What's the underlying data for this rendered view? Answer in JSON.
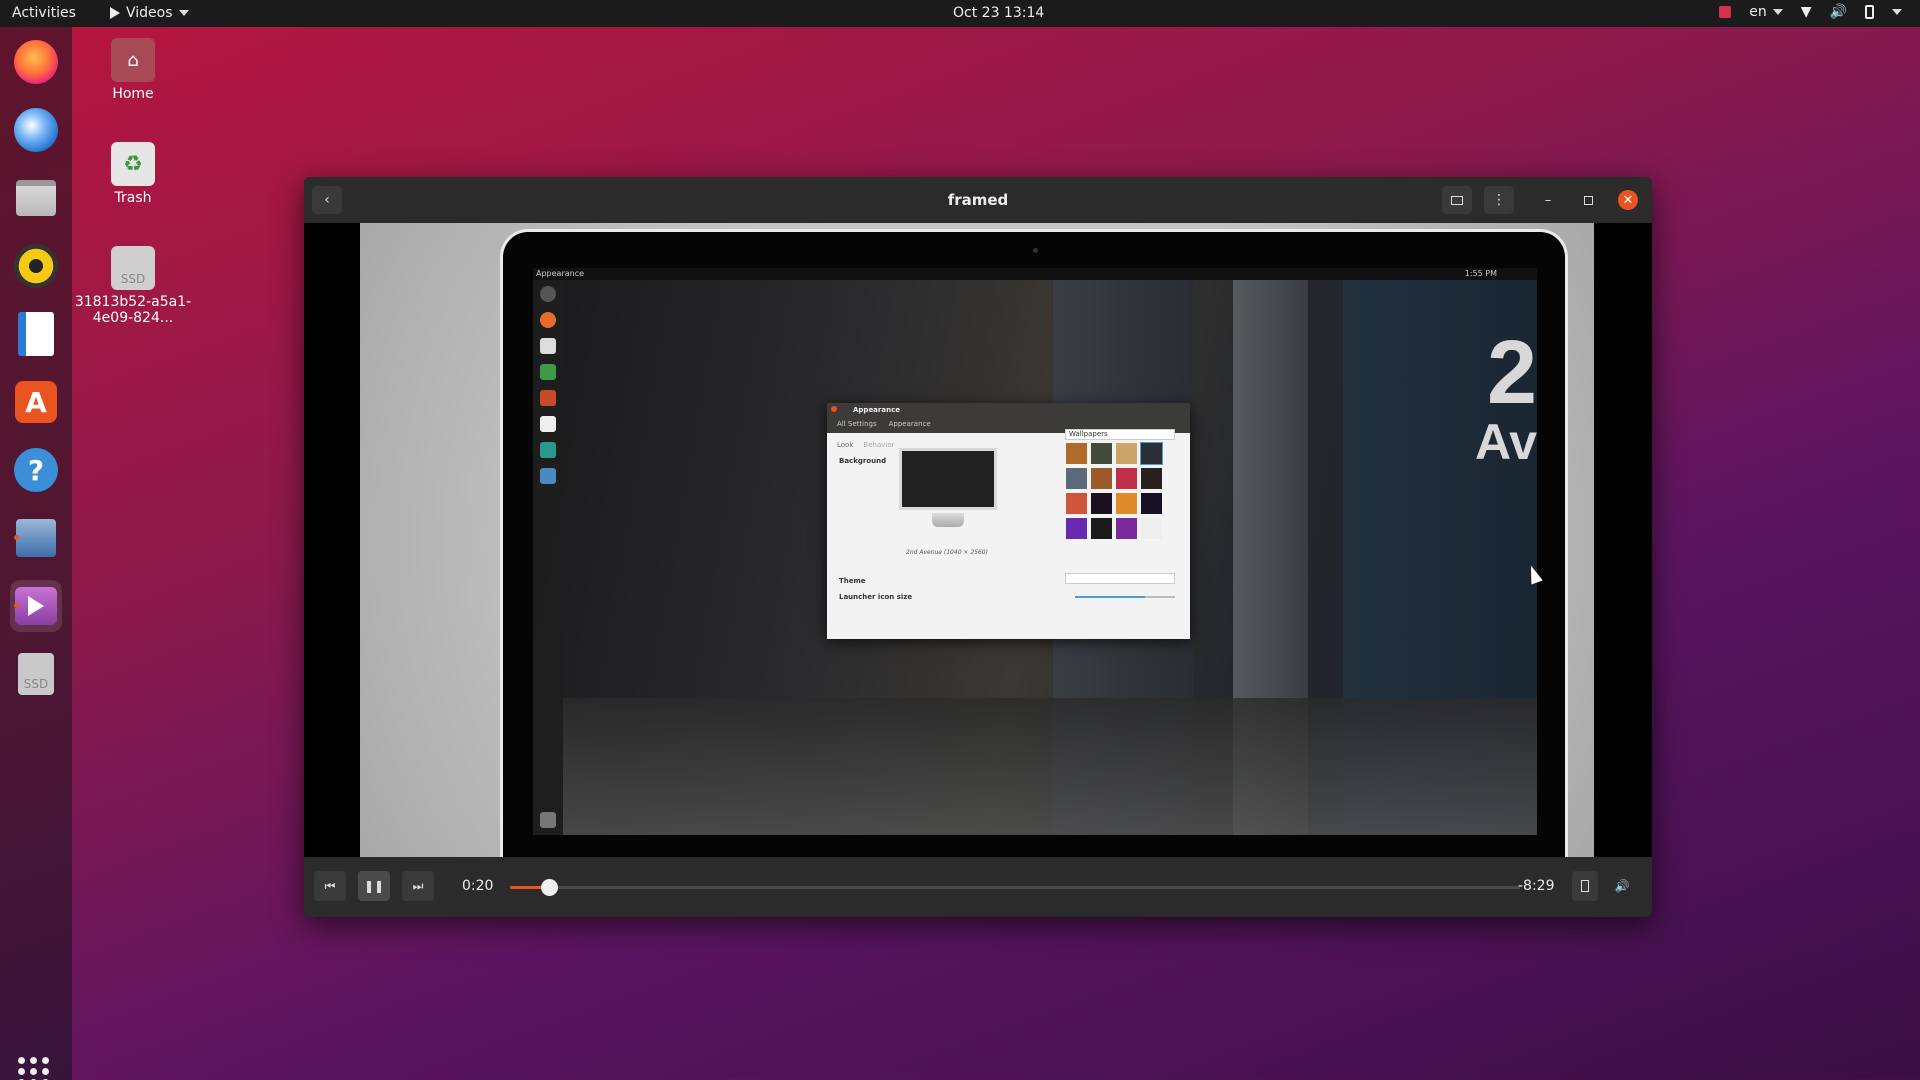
{
  "topbar": {
    "activities": "Activities",
    "app_menu": "Videos",
    "clock": "Oct 23  13:14",
    "lang": "en"
  },
  "desktop": {
    "icons": [
      {
        "label": "Home"
      },
      {
        "label": "Trash"
      },
      {
        "label": "31813b52-a5a1-4e09-824..."
      }
    ],
    "ssd_label": "SSD"
  },
  "window": {
    "title": "framed",
    "video": {
      "inner_topbar_left": "Appearance",
      "inner_topbar_right": "1:55 PM",
      "sign_number": "2",
      "sign_text": "Av",
      "appearance_dialog": {
        "title": "Appearance",
        "tabs": [
          "All Settings",
          "Appearance"
        ],
        "subtabs": [
          "Look",
          "Behavior"
        ],
        "background_label": "Background",
        "wallpaper_dropdown": "Wallpapers",
        "caption": "2nd Avenue (1040 × 2560)",
        "theme_label": "Theme",
        "launcher_icon_size_label": "Launcher icon size"
      }
    },
    "controls": {
      "elapsed": "0:20",
      "remaining": "-8:29",
      "progress": 0.039
    }
  },
  "colors": {
    "accent": "#e95420",
    "titlebar": "#2b2b2b",
    "topbar": "#1b1b1b"
  }
}
